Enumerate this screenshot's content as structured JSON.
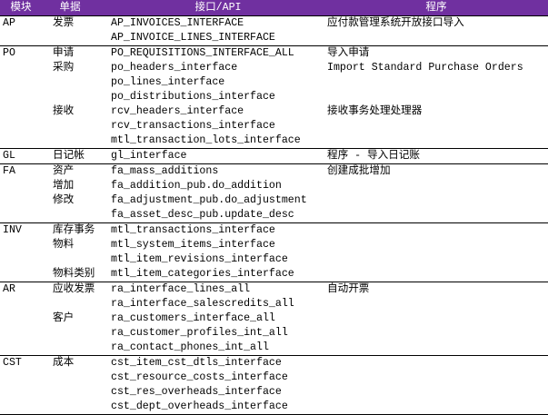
{
  "colors": {
    "header_bg": "#7030a0",
    "header_text": "#ffffff"
  },
  "header": {
    "module": "模块",
    "document": "单据",
    "api": "接口/API",
    "program": "程序"
  },
  "groups": [
    {
      "rows": [
        [
          "AP",
          "发票",
          "AP_INVOICES_INTERFACE",
          "应付款管理系统开放接口导入"
        ],
        [
          "",
          "",
          "AP_INVOICE_LINES_INTERFACE",
          ""
        ]
      ]
    },
    {
      "rows": [
        [
          "PO",
          "申请",
          "PO_REQUISITIONS_INTERFACE_ALL",
          "导入申请"
        ],
        [
          "",
          "采购",
          "po_headers_interface",
          "Import Standard Purchase Orders"
        ],
        [
          "",
          "",
          "po_lines_interface",
          ""
        ],
        [
          "",
          "",
          "po_distributions_interface",
          ""
        ],
        [
          "",
          "接收",
          "rcv_headers_interface",
          "接收事务处理处理器"
        ],
        [
          "",
          "",
          "rcv_transactions_interface",
          ""
        ],
        [
          "",
          "",
          "mtl_transaction_lots_interface",
          ""
        ]
      ]
    },
    {
      "rows": [
        [
          "GL",
          "日记帐",
          "gl_interface",
          "程序 - 导入日记账"
        ]
      ]
    },
    {
      "rows": [
        [
          "FA",
          "资产",
          "fa_mass_additions",
          "创建成批增加"
        ],
        [
          "",
          "增加",
          "fa_addition_pub.do_addition",
          ""
        ],
        [
          "",
          "修改",
          "fa_adjustment_pub.do_adjustment",
          ""
        ],
        [
          "",
          "",
          "fa_asset_desc_pub.update_desc",
          ""
        ]
      ]
    },
    {
      "rows": [
        [
          "INV",
          "库存事务",
          "mtl_transactions_interface",
          ""
        ],
        [
          "",
          "物料",
          "mtl_system_items_interface",
          ""
        ],
        [
          "",
          "",
          "mtl_item_revisions_interface",
          ""
        ],
        [
          "",
          "物料类别",
          "mtl_item_categories_interface",
          ""
        ]
      ]
    },
    {
      "rows": [
        [
          "AR",
          "应收发票",
          "ra_interface_lines_all",
          "自动开票"
        ],
        [
          "",
          "",
          "ra_interface_salescredits_all",
          ""
        ],
        [
          "",
          "客户",
          "ra_customers_interface_all",
          ""
        ],
        [
          "",
          "",
          "ra_customer_profiles_int_all",
          ""
        ],
        [
          "",
          "",
          "ra_contact_phones_int_all",
          ""
        ]
      ]
    },
    {
      "rows": [
        [
          "CST",
          "成本",
          "cst_item_cst_dtls_interface",
          ""
        ],
        [
          "",
          "",
          "cst_resource_costs_interface",
          ""
        ],
        [
          "",
          "",
          "cst_res_overheads_interface",
          ""
        ],
        [
          "",
          "",
          "cst_dept_overheads_interface",
          ""
        ]
      ]
    }
  ]
}
